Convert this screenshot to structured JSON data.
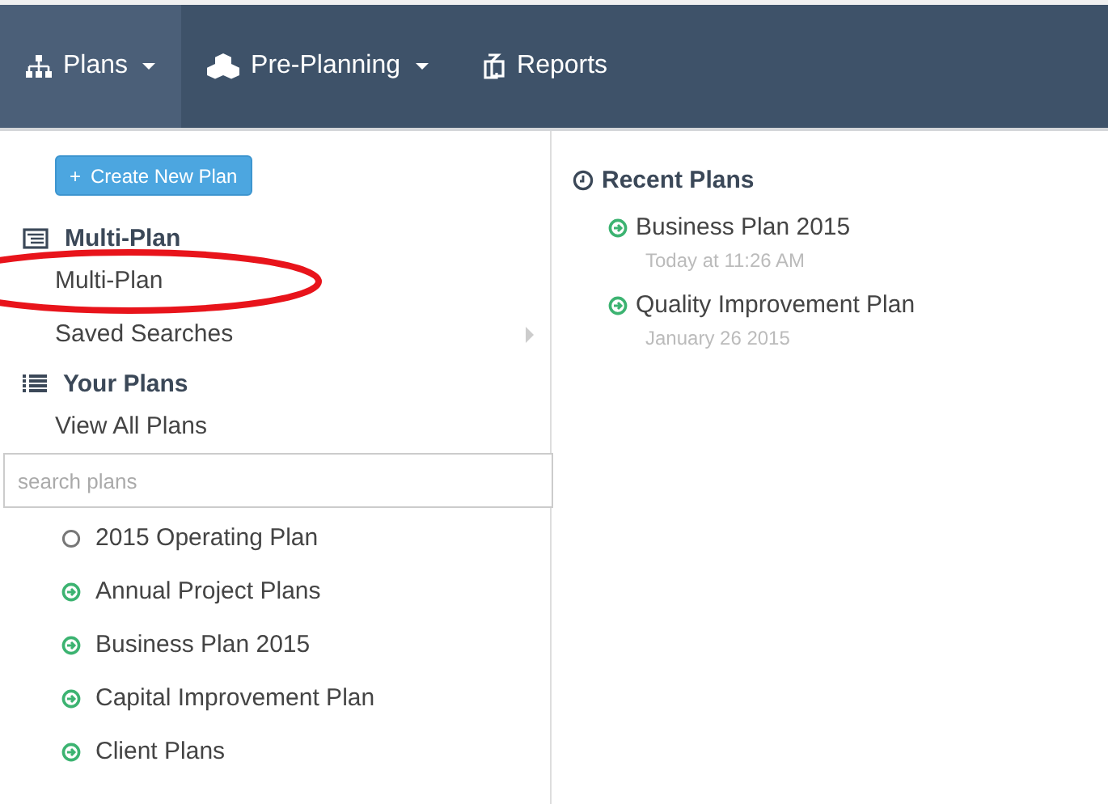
{
  "nav": [
    {
      "label": "Plans",
      "caret": true,
      "selected": true
    },
    {
      "label": "Pre-Planning",
      "caret": true,
      "selected": false
    },
    {
      "label": "Reports",
      "caret": false,
      "selected": false
    }
  ],
  "create_button": {
    "icon": "+",
    "label": "Create New Plan"
  },
  "multi_plan": {
    "title": "Multi-Plan",
    "items": [
      {
        "label": "Multi-Plan",
        "submenu": false,
        "circled": true
      },
      {
        "label": "Saved Searches",
        "submenu": true,
        "circled": false
      }
    ]
  },
  "your_plans": {
    "title": "Your Plans",
    "items": [
      {
        "label": "View All Plans",
        "submenu": false,
        "circled": false
      }
    ]
  },
  "search": {
    "placeholder": "search plans"
  },
  "plans": [
    {
      "label": "2015 Operating Plan",
      "kind": "inactive"
    },
    {
      "label": "Annual Project Plans",
      "kind": "active"
    },
    {
      "label": "Business Plan 2015",
      "kind": "active"
    },
    {
      "label": "Capital Improvement Plan",
      "kind": "active"
    },
    {
      "label": "Client Plans",
      "kind": "active"
    }
  ],
  "recent": {
    "title": "Recent Plans",
    "items": [
      {
        "label": "Business Plan 2015",
        "date": "Today at 11:26 AM",
        "kind": "active"
      },
      {
        "label": "Quality Improvement Plan",
        "date": "January 26 2015",
        "kind": "active"
      }
    ]
  }
}
